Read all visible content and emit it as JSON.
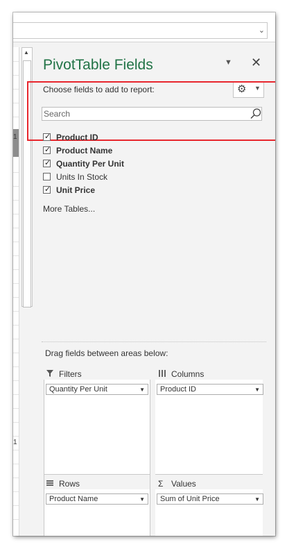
{
  "pane": {
    "title": "PivotTable Fields",
    "choose_label": "Choose fields to add to report:",
    "search_placeholder": "Search",
    "more_tables": "More Tables...",
    "drag_label": "Drag fields between areas below:"
  },
  "fields": [
    {
      "label": "Product ID",
      "checked": true
    },
    {
      "label": "Product Name",
      "checked": true
    },
    {
      "label": "Quantity Per Unit",
      "checked": true
    },
    {
      "label": "Units In Stock",
      "checked": false
    },
    {
      "label": "Unit Price",
      "checked": true
    }
  ],
  "areas": {
    "filters": {
      "label": "Filters",
      "item": "Quantity Per Unit"
    },
    "columns": {
      "label": "Columns",
      "item": "Product ID"
    },
    "rows": {
      "label": "Rows",
      "item": "Product Name"
    },
    "values": {
      "label": "Values",
      "item": "Sum of Unit Price"
    }
  },
  "strip_marks": [
    "1",
    "1"
  ],
  "colors": {
    "accent": "#217346",
    "highlight": "#e8262d"
  }
}
